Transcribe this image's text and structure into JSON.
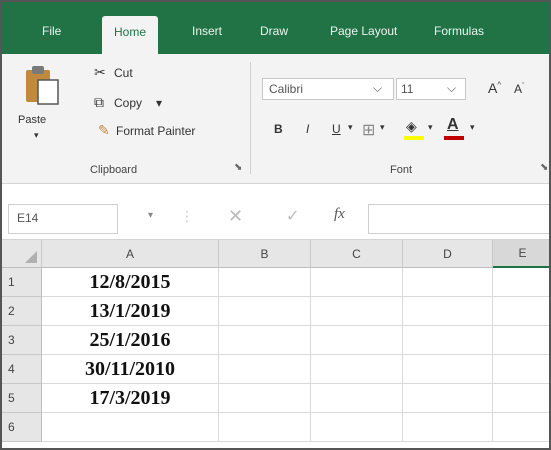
{
  "ribbon_tabs": [
    {
      "label": "File"
    },
    {
      "label": "Home"
    },
    {
      "label": "Insert"
    },
    {
      "label": "Draw"
    },
    {
      "label": "Page Layout"
    },
    {
      "label": "Formulas"
    }
  ],
  "clipboard": {
    "paste_label": "Paste",
    "cut_label": "Cut",
    "copy_label": "Copy",
    "copy_dropdown": "▾",
    "format_painter_label": "Format Painter",
    "group_label": "Clipboard"
  },
  "font": {
    "font_name": "Calibri",
    "font_size": "11",
    "grow_font": "A",
    "shrink_font": "A",
    "bold": "B",
    "italic": "I",
    "underline": "U",
    "group_label": "Font"
  },
  "formula_bar": {
    "name_box": "E14",
    "formula": ""
  },
  "sheet": {
    "columns": [
      "A",
      "B",
      "C",
      "D",
      "E"
    ],
    "rows": [
      {
        "num": "1",
        "A": "12/8/2015"
      },
      {
        "num": "2",
        "A": "13/1/2019"
      },
      {
        "num": "3",
        "A": "25/1/2016"
      },
      {
        "num": "4",
        "A": "30/11/2010"
      },
      {
        "num": "5",
        "A": "17/3/2019"
      },
      {
        "num": "6",
        "A": ""
      }
    ]
  },
  "colors": {
    "accent": "#217346",
    "font_color_bar": "#c00000",
    "highlight_bar": "#ffff00"
  }
}
